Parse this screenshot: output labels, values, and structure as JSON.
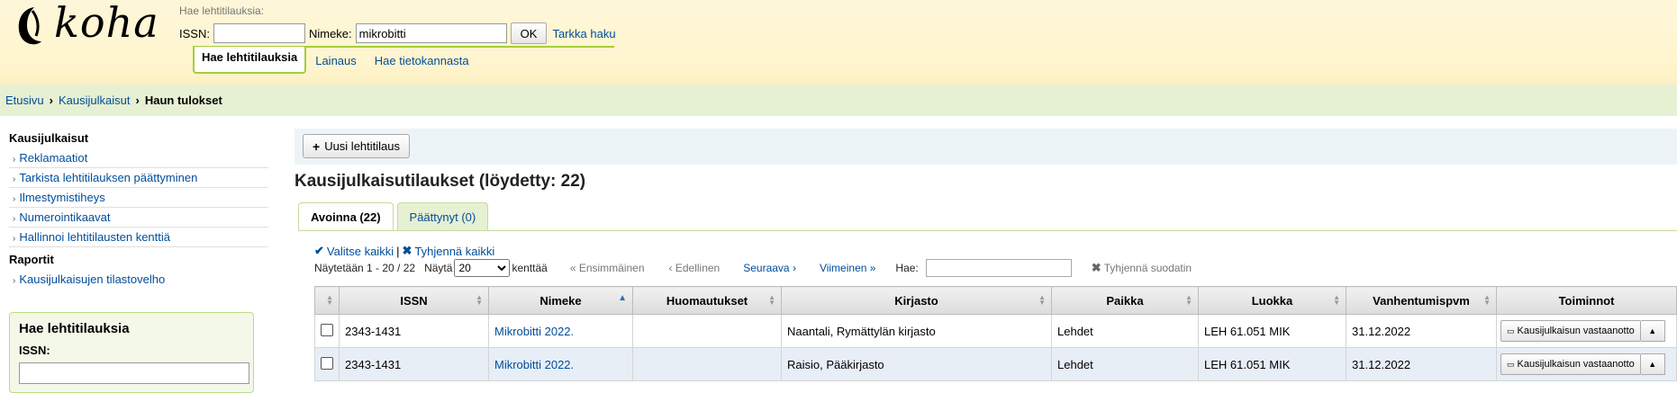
{
  "app": {
    "logo_text": "koha"
  },
  "header_search": {
    "caption": "Hae lehtitilauksia:",
    "issn_label": "ISSN:",
    "issn_value": "",
    "title_label": "Nimeke:",
    "title_value": "mikrobitti",
    "ok_label": "OK",
    "advanced_label": "Tarkka haku",
    "tabs": [
      {
        "label": "Hae lehtitilauksia",
        "active": true
      },
      {
        "label": "Lainaus",
        "active": false
      },
      {
        "label": "Hae tietokannasta",
        "active": false
      }
    ]
  },
  "breadcrumb": {
    "home": "Etusivu",
    "serials": "Kausijulkaisut",
    "current": "Haun tulokset"
  },
  "sidebar": {
    "section1_title": "Kausijulkaisut",
    "section1_items": [
      "Reklamaatiot",
      "Tarkista lehtitilauksen päättyminen",
      "Ilmestymistiheys",
      "Numerointikaavat",
      "Hallinnoi lehtitilausten kenttiä"
    ],
    "section2_title": "Raportit",
    "section2_items": [
      "Kausijulkaisujen tilastovelho"
    ],
    "search_box_title": "Hae lehtitilauksia",
    "search_box_issn_label": "ISSN:"
  },
  "main": {
    "new_subscription_label": "Uusi lehtitilaus",
    "results_title": "Kausijulkaisutilaukset (löydetty: 22)",
    "tabs": [
      {
        "label": "Avoinna (22)",
        "active": true
      },
      {
        "label": "Päättynyt (0)",
        "active": false
      }
    ],
    "select_all": "Valitse kaikki",
    "divider": "|",
    "clear_all": "Tyhjennä kaikki",
    "showing": "Näytetään 1 - 20 / 22",
    "show_label": "Näytä",
    "page_size": "20",
    "entries_label": "kenttää",
    "first": "« Ensimmäinen",
    "previous": "‹ Edellinen",
    "next": "Seuraava ›",
    "last": "Viimeinen »",
    "search_label": "Hae:",
    "clear_filter": "Tyhjennä suodatin"
  },
  "table": {
    "headers": [
      "",
      "ISSN",
      "Nimeke",
      "Huomautukset",
      "Kirjasto",
      "Paikka",
      "Luokka",
      "Vanhentumispvm",
      "Toiminnot"
    ],
    "sorted_column": "Nimeke",
    "rows": [
      {
        "issn": "2343-1431",
        "title": "Mikrobitti 2022.",
        "notes": "",
        "library": "Naantali, Rymättylän kirjasto",
        "location": "Lehdet",
        "callnumber": "LEH 61.051 MIK",
        "expiration": "31.12.2022",
        "action": "Kausijulkaisun vastaanotto"
      },
      {
        "issn": "2343-1431",
        "title": "Mikrobitti 2022.",
        "notes": "",
        "library": "Raisio, Pääkirjasto",
        "location": "Lehdet",
        "callnumber": "LEH 61.051 MIK",
        "expiration": "31.12.2022",
        "action": "Kausijulkaisun vastaanotto"
      }
    ]
  }
}
